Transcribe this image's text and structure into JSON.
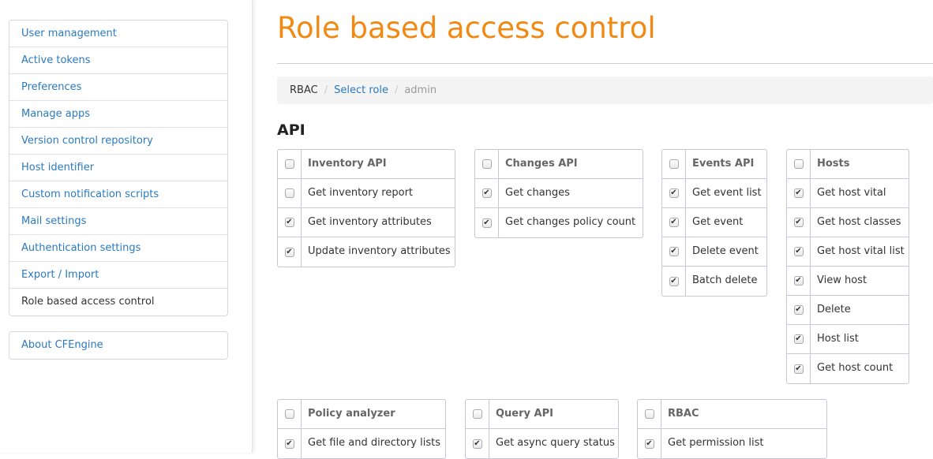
{
  "sidebar": {
    "items": [
      "User management",
      "Active tokens",
      "Preferences",
      "Manage apps",
      "Version control repository",
      "Host identifier",
      "Custom notification scripts",
      "Mail settings",
      "Authentication settings",
      "Export / Import",
      "Role based access control"
    ],
    "active": 10,
    "about": "About CFEngine"
  },
  "page": {
    "title": "Role based access control",
    "breadcrumb": [
      "RBAC",
      "Select role",
      "admin"
    ],
    "section": "API"
  },
  "groups": [
    {
      "title": "Inventory API",
      "checked": false,
      "perms": [
        {
          "label": "Get inventory report",
          "checked": false
        },
        {
          "label": "Get inventory attributes",
          "checked": true
        },
        {
          "label": "Update inventory attributes",
          "checked": true
        }
      ]
    },
    {
      "title": "Changes API",
      "checked": false,
      "perms": [
        {
          "label": "Get changes",
          "checked": true
        },
        {
          "label": "Get changes policy count",
          "checked": true
        }
      ]
    },
    {
      "title": "Events API",
      "checked": false,
      "perms": [
        {
          "label": "Get event list",
          "checked": true
        },
        {
          "label": "Get event",
          "checked": true
        },
        {
          "label": "Delete event",
          "checked": true
        },
        {
          "label": "Batch delete",
          "checked": true
        }
      ]
    },
    {
      "title": "Hosts",
      "checked": false,
      "perms": [
        {
          "label": "Get host vital",
          "checked": true
        },
        {
          "label": "Get host classes",
          "checked": true
        },
        {
          "label": "Get host vital list",
          "checked": true
        },
        {
          "label": "View host",
          "checked": true
        },
        {
          "label": "Delete",
          "checked": true
        },
        {
          "label": "Host list",
          "checked": true
        },
        {
          "label": "Get host count",
          "checked": true
        }
      ]
    },
    {
      "title": "Policy analyzer",
      "checked": false,
      "perms": [
        {
          "label": "Get file and directory lists",
          "checked": true
        }
      ]
    },
    {
      "title": "Query API",
      "checked": false,
      "perms": [
        {
          "label": "Get async query status",
          "checked": true
        }
      ]
    },
    {
      "title": "RBAC",
      "checked": false,
      "perms": [
        {
          "label": "Get permission list",
          "checked": true
        }
      ]
    }
  ]
}
